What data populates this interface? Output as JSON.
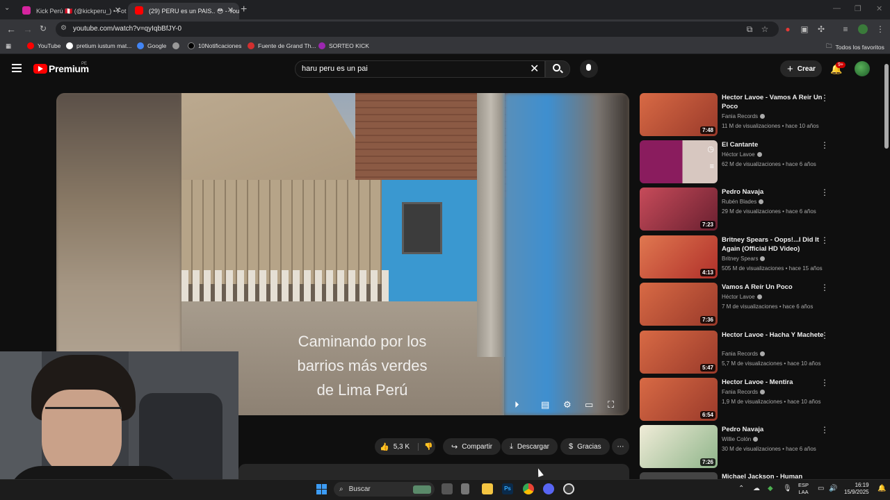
{
  "browser": {
    "tabs": [
      {
        "title": "Kick Perú 🇵🇪 (@kickperu_) • Fot",
        "favicon_color": "#d6249f"
      },
      {
        "title": "(29) PERU es un PAIS.. 😳 - You",
        "favicon_color": "#ff0000"
      }
    ],
    "url": "youtube.com/watch?v=qyIqbBfJY-0",
    "bookmarks": [
      {
        "label": "YouTube",
        "color": "#ff0000"
      },
      {
        "label": "pretium iustum mat...",
        "color": "#ffffff"
      },
      {
        "label": "Google",
        "color": "#4285f4"
      },
      {
        "label": "",
        "color": "#999999"
      },
      {
        "label": "10Notificaciones",
        "color": "#000000"
      },
      {
        "label": "Fuente de Grand Th...",
        "color": "#d32f2f"
      },
      {
        "label": "SORTEO KICK",
        "color": "#9c27b0"
      }
    ],
    "all_bookmarks": "Todos los favoritos"
  },
  "youtube": {
    "logo_text": "Premium",
    "country": "PE",
    "search_value": "haru peru es un pai",
    "create_label": "Crear",
    "notif_badge": "9+",
    "player": {
      "subtitle_lines": [
        "Caminando por los",
        "barrios más verdes",
        "de Lima Perú"
      ]
    },
    "actions": {
      "likes": "5,3 K",
      "share": "Compartir",
      "download": "Descargar",
      "thanks": "Gracias"
    },
    "recommendations": [
      {
        "title": "Hector Lavoe - Vamos A Reir Un Poco",
        "channel": "Fania Records",
        "meta": "11 M de visualizaciones • hace 10 años",
        "duration": "7:48",
        "thumb": "#b5543a"
      },
      {
        "title": "El Cantante",
        "channel": "Héctor Lavoe",
        "meta": "62 M de visualizaciones • hace 6 años",
        "duration": "",
        "thumb": "#8a1c5e"
      },
      {
        "title": "Pedro Navaja",
        "channel": "Rubén Blades",
        "meta": "29 M de visualizaciones • hace 6 años",
        "duration": "7:23",
        "thumb": "#b33b4a"
      },
      {
        "title": "Britney Spears - Oops!...I Did It Again (Official HD Video)",
        "channel": "Britney Spears",
        "meta": "505 M de visualizaciones • hace 15 años",
        "duration": "4:13",
        "thumb": "#c84a2a"
      },
      {
        "title": "Vamos A Reír Un Poco",
        "channel": "Héctor Lavoe",
        "meta": "7 M de visualizaciones • hace 6 años",
        "duration": "7:36",
        "thumb": "#b5543a"
      },
      {
        "title": "Hector Lavoe - Hacha Y Machete",
        "channel": "Fania Records",
        "meta": "5,7 M de visualizaciones • hace 10 años",
        "duration": "5:47",
        "thumb": "#b5543a"
      },
      {
        "title": "Hector Lavoe - Mentira",
        "channel": "Fania Records",
        "meta": "1,9 M de visualizaciones • hace 10 años",
        "duration": "6:54",
        "thumb": "#b5543a"
      },
      {
        "title": "Pedro Navaja",
        "channel": "Willie Colón",
        "meta": "30 M de visualizaciones • hace 6 años",
        "duration": "7:26",
        "thumb": "#e9e4d0"
      }
    ],
    "partial_next_title": "Michael Jackson - Human"
  },
  "taskbar": {
    "search_label": "Buscar",
    "lang_line1": "ESP",
    "lang_line2": "LAA",
    "time": "16:19",
    "date": "15/9/2025"
  }
}
